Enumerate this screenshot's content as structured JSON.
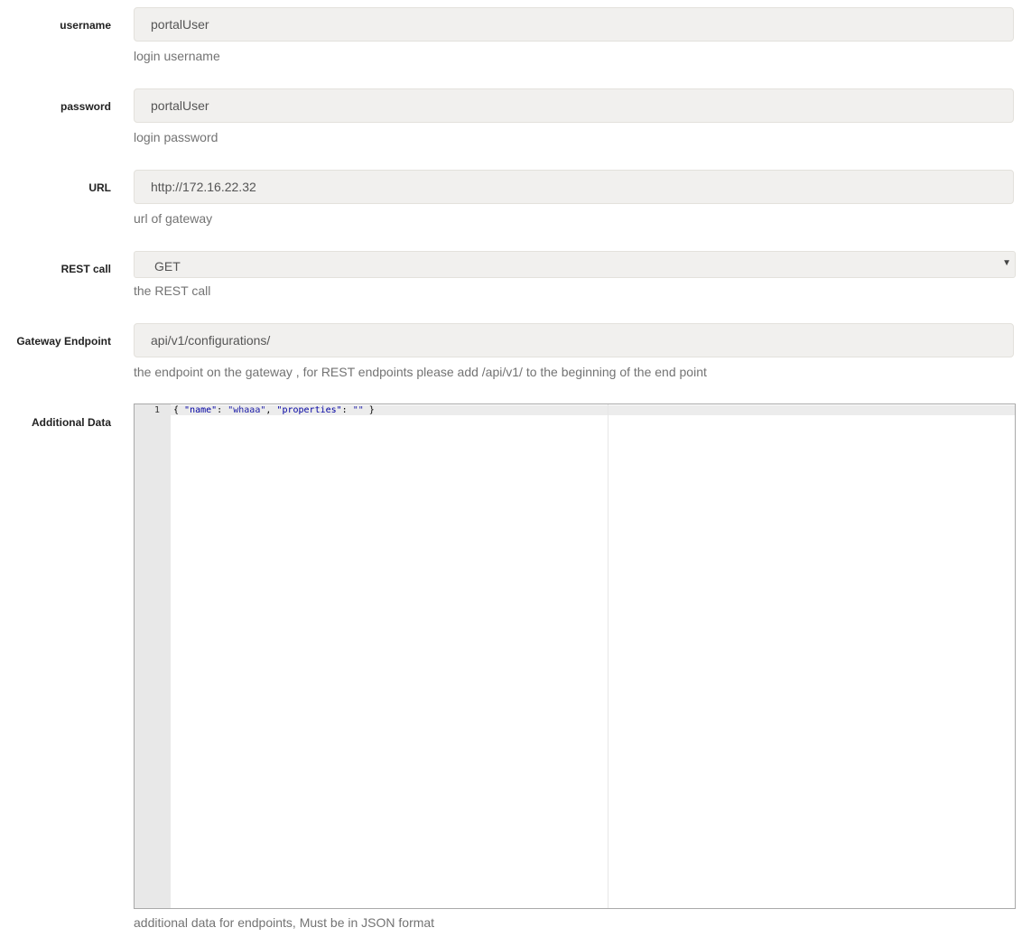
{
  "fields": {
    "username": {
      "label": "username",
      "value": "portalUser",
      "help": "login username"
    },
    "password": {
      "label": "password",
      "value": "portalUser",
      "help": "login password"
    },
    "url": {
      "label": "URL",
      "value": "http://172.16.22.32",
      "help": "url of gateway"
    },
    "rest_call": {
      "label": "REST call",
      "selected": "GET",
      "help": "the REST call"
    },
    "gateway_endpoint": {
      "label": "Gateway Endpoint",
      "value": "api/v1/configurations/",
      "help": "the endpoint on the gateway , for REST endpoints please add /api/v1/ to the beginning of the end point"
    },
    "additional_data": {
      "label": "Additional Data",
      "help": "additional data for endpoints, Must be in JSON format",
      "editor": {
        "line_number": "1",
        "tokens": {
          "open_brace": "{ ",
          "key1": "\"name\"",
          "colon1": ": ",
          "val1": "\"whaaa\"",
          "comma": ", ",
          "key2": "\"properties\"",
          "colon2": ": ",
          "val2": "\"\"",
          "close_brace": " }"
        }
      }
    }
  },
  "icons": {
    "select_arrow": "chevron-down-icon"
  },
  "colors": {
    "field_background": "#f1f0ee",
    "help_text": "#737373",
    "json_key": "#0000a2",
    "json_string": "#1a1aa6"
  }
}
